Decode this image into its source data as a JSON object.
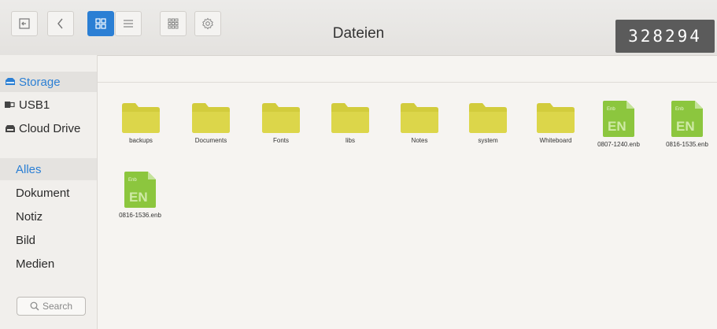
{
  "toolbar": {
    "title": "Dateien",
    "code": "328294"
  },
  "sidebar": {
    "sources": [
      {
        "label": "Storage",
        "icon": "drive-icon",
        "selected": true
      },
      {
        "label": "USB1",
        "icon": "usb-icon",
        "selected": false
      },
      {
        "label": "Cloud Drive",
        "icon": "cloud-drive-icon",
        "selected": false
      }
    ],
    "categories": [
      {
        "label": "Alles",
        "selected": true
      },
      {
        "label": "Dokument",
        "selected": false
      },
      {
        "label": "Notiz",
        "selected": false
      },
      {
        "label": "Bild",
        "selected": false
      },
      {
        "label": "Medien",
        "selected": false
      }
    ],
    "search_placeholder": "Search"
  },
  "files": [
    {
      "name": "backups",
      "type": "folder"
    },
    {
      "name": "Documents",
      "type": "folder"
    },
    {
      "name": "Fonts",
      "type": "folder"
    },
    {
      "name": "libs",
      "type": "folder"
    },
    {
      "name": "Notes",
      "type": "folder"
    },
    {
      "name": "system",
      "type": "folder"
    },
    {
      "name": "Whiteboard",
      "type": "folder"
    },
    {
      "name": "0807-1240.enb",
      "type": "enb",
      "badge": "Enb",
      "mark": "EN"
    },
    {
      "name": "0816-1535.enb",
      "type": "enb",
      "badge": "Enb",
      "mark": "EN"
    },
    {
      "name": "0816-1536.enb",
      "type": "enb",
      "badge": "Enb",
      "mark": "EN"
    }
  ],
  "colors": {
    "accent": "#2b7fd4",
    "folder": "#d2cc3c",
    "enb": "#8cc63e"
  }
}
